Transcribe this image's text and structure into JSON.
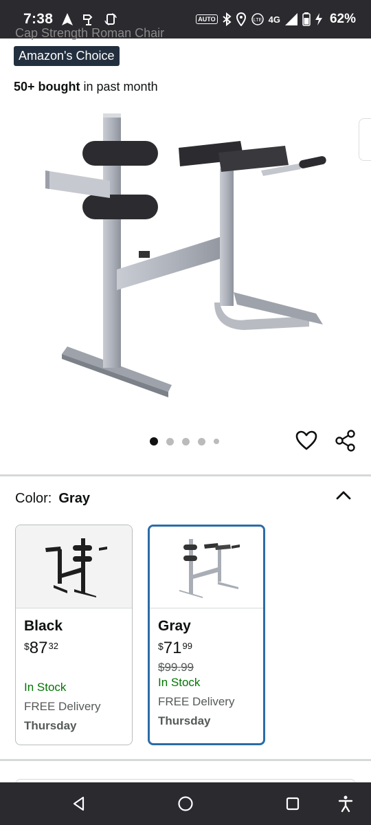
{
  "status_bar": {
    "time": "7:38",
    "network": "4G",
    "battery_percent": "62%"
  },
  "product": {
    "title_partial": "Cap Strength Roman Chair",
    "badge": "Amazon's Choice",
    "bought_bold": "50+ bought",
    "bought_rest": " in past month"
  },
  "carousel": {
    "dot_count": 5,
    "active_index": 0
  },
  "variation": {
    "label": "Color:",
    "selected": "Gray",
    "options": [
      {
        "name": "Black",
        "currency": "$",
        "price_whole": "87",
        "price_fraction": "32",
        "list_price": "",
        "stock": "In Stock",
        "delivery": "FREE Delivery",
        "delivery_day": "Thursday",
        "frame_color": "#1e1e1e"
      },
      {
        "name": "Gray",
        "currency": "$",
        "price_whole": "71",
        "price_fraction": "99",
        "list_price": "$99.99",
        "stock": "In Stock",
        "delivery": "FREE Delivery",
        "delivery_day": "Thursday",
        "frame_color": "#a9adb5"
      }
    ]
  },
  "colors": {
    "status_bar_bg": "#2a2a2f",
    "badge_bg": "#232f3e",
    "in_stock": "#007600",
    "selected_border": "#2a6ca8"
  }
}
